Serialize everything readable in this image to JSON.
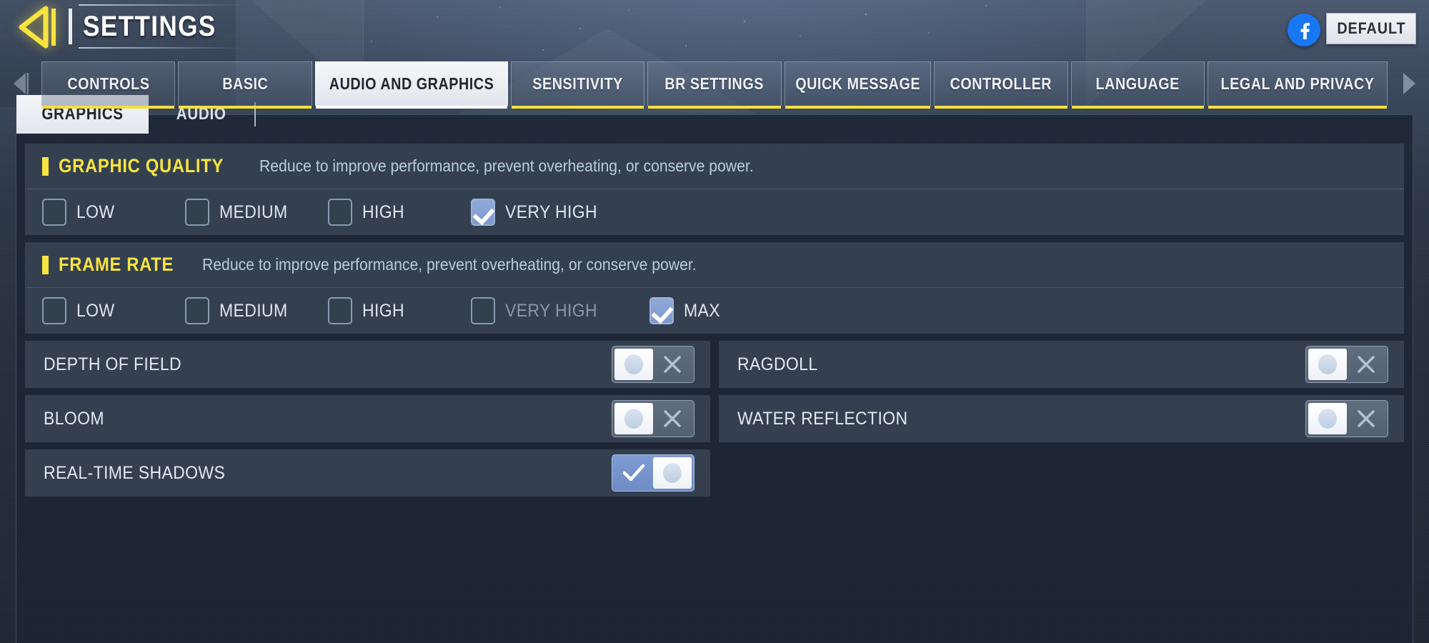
{
  "header": {
    "title": "SETTINGS",
    "back_icon": "back-arrow-icon",
    "facebook_icon": "facebook-icon",
    "default_label": "DEFAULT"
  },
  "tabbar": {
    "prev_icon": "chevron-left-icon",
    "next_icon": "chevron-right-icon",
    "tabs": [
      {
        "label": "CONTROLS",
        "active": false
      },
      {
        "label": "BASIC",
        "active": false
      },
      {
        "label": "AUDIO AND GRAPHICS",
        "active": true
      },
      {
        "label": "SENSITIVITY",
        "active": false
      },
      {
        "label": "BR SETTINGS",
        "active": false
      },
      {
        "label": "QUICK MESSAGE",
        "active": false
      },
      {
        "label": "CONTROLLER",
        "active": false
      },
      {
        "label": "LANGUAGE",
        "active": false
      },
      {
        "label": "LEGAL AND PRIVACY",
        "active": false
      }
    ]
  },
  "subtabs": [
    {
      "label": "GRAPHICS",
      "active": true
    },
    {
      "label": "AUDIO",
      "active": false
    }
  ],
  "groups": [
    {
      "title": "GRAPHIC QUALITY",
      "description": "Reduce to improve performance, prevent overheating, or conserve power.",
      "options": [
        {
          "label": "LOW",
          "checked": false,
          "dimmed": false
        },
        {
          "label": "MEDIUM",
          "checked": false,
          "dimmed": false
        },
        {
          "label": "HIGH",
          "checked": false,
          "dimmed": false
        },
        {
          "label": "VERY HIGH",
          "checked": true,
          "dimmed": false
        }
      ]
    },
    {
      "title": "FRAME RATE",
      "description": "Reduce to improve performance, prevent overheating, or conserve power.",
      "options": [
        {
          "label": "LOW",
          "checked": false,
          "dimmed": false
        },
        {
          "label": "MEDIUM",
          "checked": false,
          "dimmed": false
        },
        {
          "label": "HIGH",
          "checked": false,
          "dimmed": false
        },
        {
          "label": "VERY HIGH",
          "checked": false,
          "dimmed": true
        },
        {
          "label": "MAX",
          "checked": true,
          "dimmed": false
        }
      ]
    }
  ],
  "toggles": [
    {
      "label": "DEPTH OF FIELD",
      "on": false
    },
    {
      "label": "RAGDOLL",
      "on": false
    },
    {
      "label": "BLOOM",
      "on": false
    },
    {
      "label": "WATER REFLECTION",
      "on": false
    },
    {
      "label": "REAL-TIME SHADOWS",
      "on": true
    }
  ],
  "colors": {
    "accent_yellow": "#f7e441",
    "toggle_on_blue": "#7e9bd2",
    "checkbox_checked": "#8fa9d8",
    "facebook_blue": "#1877f2",
    "panel_bg": "#1d2634",
    "card_bg": "#424f60"
  }
}
